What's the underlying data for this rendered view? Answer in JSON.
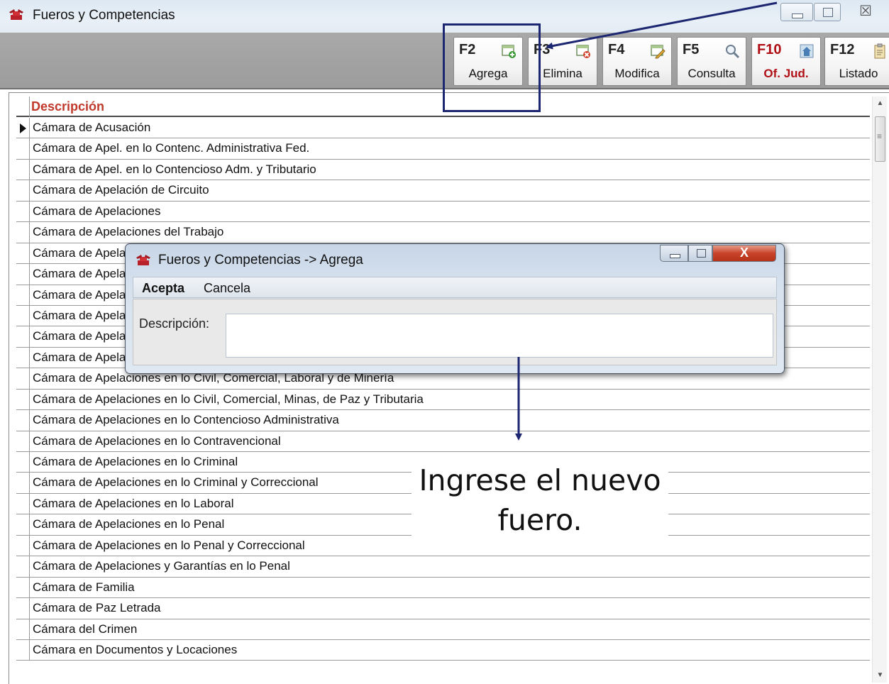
{
  "window": {
    "title": "Fueros y Competencias",
    "close_glyph": "☒"
  },
  "toolbar": {
    "buttons": [
      {
        "key": "F2",
        "label": "Agrega",
        "icon": "add-record-icon"
      },
      {
        "key": "F3",
        "label": "Elimina",
        "icon": "delete-record-icon"
      },
      {
        "key": "F4",
        "label": "Modifica",
        "icon": "edit-record-icon"
      },
      {
        "key": "F5",
        "label": "Consulta",
        "icon": "search-icon"
      },
      {
        "key": "F10",
        "label": "Of. Jud.",
        "icon": "building-icon"
      },
      {
        "key": "F12",
        "label": "Listado",
        "icon": "clipboard-icon"
      }
    ]
  },
  "grid": {
    "column": "Descripción",
    "rows": [
      "Cámara de Acusación",
      "Cámara de Apel. en lo Contenc. Administrativa Fed.",
      "Cámara de Apel. en lo Contencioso Adm. y Tributario",
      "Cámara de Apelación de Circuito",
      "Cámara de Apelaciones",
      "Cámara de Apelaciones del Trabajo",
      "Cámara de Apela",
      "Cámara de Apela",
      "Cámara de Apela",
      "Cámara de Apela",
      "Cámara de Apela",
      "Cámara de Apela",
      "Cámara de Apelaciones en lo Civil, Comercial, Laboral y de Minería",
      "Cámara de Apelaciones en lo Civil, Comercial, Minas, de Paz y Tributaria",
      "Cámara de Apelaciones en lo Contencioso Administrativa",
      "Cámara de Apelaciones en lo Contravencional",
      "Cámara de Apelaciones en lo Criminal",
      "Cámara de Apelaciones en lo Criminal y Correccional",
      "Cámara de Apelaciones en lo Laboral",
      "Cámara de Apelaciones en lo Penal",
      "Cámara de Apelaciones en lo Penal y Correccional",
      "Cámara de Apelaciones y Garantías en lo Penal",
      "Cámara de Familia",
      "Cámara de Paz Letrada",
      "Cámara del Crimen",
      "Cámara en Documentos y Locaciones"
    ]
  },
  "dialog": {
    "title": "Fueros y Competencias -> Agrega",
    "close_label": "X",
    "menu": {
      "accept": "Acepta",
      "cancel": "Cancela"
    },
    "field_label": "Descripción:",
    "field_value": ""
  },
  "annotation": {
    "caption_line1": "Ingrese el nuevo",
    "caption_line2": "fuero.",
    "color": "#1d2670"
  }
}
